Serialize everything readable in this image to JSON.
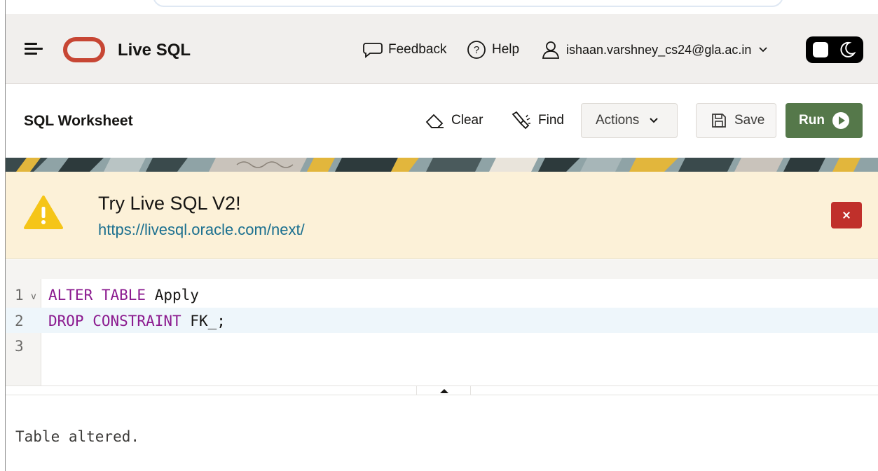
{
  "header": {
    "app_title": "Live SQL",
    "feedback_label": "Feedback",
    "help_label": "Help",
    "user_email": "ishaan.varshney_cs24@gla.ac.in",
    "icons": [
      "menu-icon",
      "oracle-logo",
      "speech-bubble-icon",
      "question-circle-icon",
      "user-icon",
      "chevron-down-icon",
      "moon-icon"
    ]
  },
  "toolbar": {
    "title": "SQL Worksheet",
    "clear_label": "Clear",
    "find_label": "Find",
    "actions_label": "Actions",
    "save_label": "Save",
    "run_label": "Run",
    "icons": [
      "eraser-icon",
      "flashlight-icon",
      "chevron-down-icon",
      "floppy-disk-icon",
      "play-circle-icon"
    ]
  },
  "alert": {
    "title": "Try Live SQL V2!",
    "link": "https://livesql.oracle.com/next/",
    "icons": [
      "warning-icon",
      "close-icon"
    ]
  },
  "editor": {
    "lines": [
      {
        "number": "1",
        "keyword": "ALTER TABLE",
        "rest": " Apply"
      },
      {
        "number": "2",
        "keyword": "DROP CONSTRAINT",
        "rest": " FK_;"
      },
      {
        "number": "3",
        "keyword": "",
        "rest": ""
      }
    ],
    "active_line": "2"
  },
  "output": {
    "text": "Table altered."
  },
  "colors": {
    "oracle_red": "#c74634",
    "run_green": "#55784a",
    "alert_bg": "#fcf1d8",
    "link_blue": "#1a6f8f",
    "keyword_purple": "#8b1a8f",
    "close_red": "#c0302b"
  }
}
